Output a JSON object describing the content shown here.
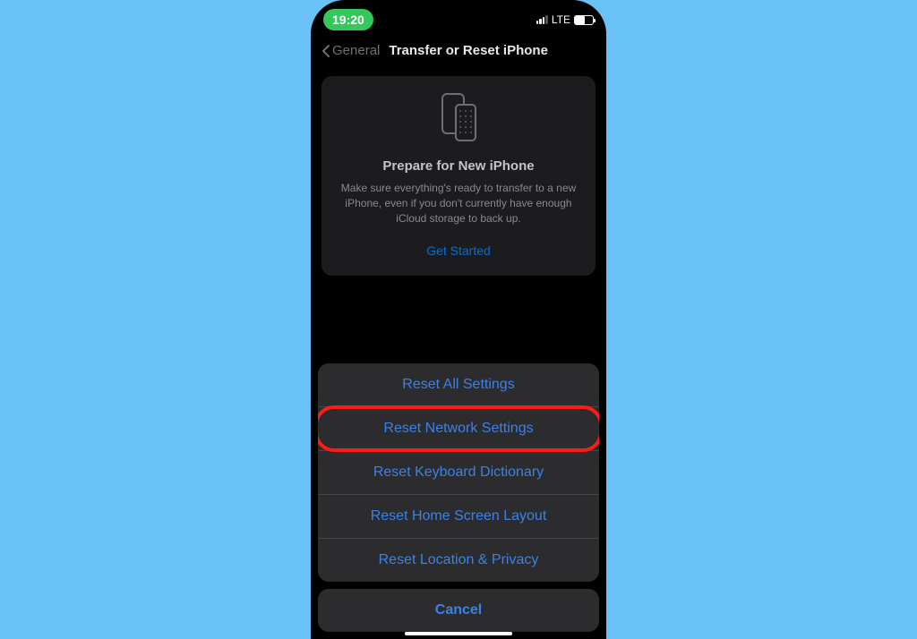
{
  "status": {
    "time": "19:20",
    "network_label": "LTE"
  },
  "nav": {
    "back_label": "General",
    "title": "Transfer or Reset iPhone"
  },
  "prepare": {
    "title": "Prepare for New iPhone",
    "subtitle": "Make sure everything's ready to transfer to a new iPhone, even if you don't currently have enough iCloud storage to back up.",
    "cta": "Get Started"
  },
  "sheet": {
    "items": [
      {
        "label": "Reset All Settings"
      },
      {
        "label": "Reset Network Settings"
      },
      {
        "label": "Reset Keyboard Dictionary"
      },
      {
        "label": "Reset Home Screen Layout"
      },
      {
        "label": "Reset Location & Privacy"
      }
    ],
    "cancel": "Cancel"
  }
}
